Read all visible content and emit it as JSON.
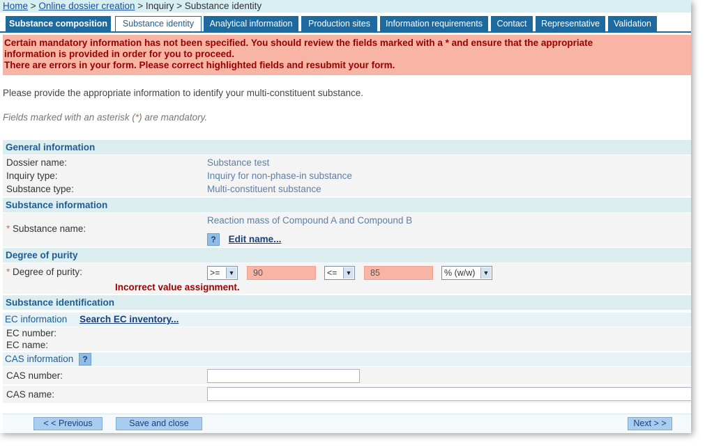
{
  "breadcrumb": {
    "home": "Home",
    "sep1": " > ",
    "online": "Online dossier creation",
    "rest": " > Inquiry > Substance identity"
  },
  "tabs": [
    {
      "label": "Substance composition"
    },
    {
      "label": "Substance identity"
    },
    {
      "label": "Analytical information"
    },
    {
      "label": "Production sites"
    },
    {
      "label": "Information requirements"
    },
    {
      "label": "Contact"
    },
    {
      "label": "Representative"
    },
    {
      "label": "Validation"
    }
  ],
  "errors": {
    "line1": "Certain mandatory information has not been specified. You should review the fields marked with a * and ensure that the appropriate",
    "line2": "information is provided in order for you to proceed.",
    "line3": "There are errors in your form. Please correct highlighted fields and resubmit your form."
  },
  "intro": "Please provide the appropriate information to identify your multi-constituent substance.",
  "mandatory_note": {
    "before": "Fields marked with an asterisk (",
    "asterisk": "*",
    "after": ") are mandatory."
  },
  "general": {
    "heading": "General information",
    "dossier_label": "Dossier name:",
    "dossier_value": "Substance test",
    "inquiry_label": "Inquiry type:",
    "inquiry_value": "Inquiry for non-phase-in substance",
    "subtype_label": "Substance type:",
    "subtype_value": "Multi-constituent substance"
  },
  "substance": {
    "heading": "Substance information",
    "asterisk": "*",
    "name_label": "Substance name:",
    "name_value": "Reaction mass of Compound A and Compound B",
    "help": "?",
    "edit_link": "Edit name..."
  },
  "purity": {
    "heading": "Degree of purity",
    "asterisk": "*",
    "label": "Degree of purity:",
    "op1": ">=",
    "val1": "90",
    "op2": "<=",
    "val2": "85",
    "unit": "% (w/w)",
    "error": "Incorrect value assignment.",
    "arrow": "▼"
  },
  "identification": {
    "heading": "Substance identification",
    "ec_title": "EC information",
    "ec_link": "Search EC inventory...",
    "ec_number_label": "EC number:",
    "ec_name_label": "EC name:",
    "cas_title": "CAS information",
    "cas_help": "?",
    "cas_number_label": "CAS number:",
    "cas_name_label": "CAS name:"
  },
  "footer": {
    "previous": "< < Previous",
    "save": "Save and close",
    "next": "Next > >"
  }
}
